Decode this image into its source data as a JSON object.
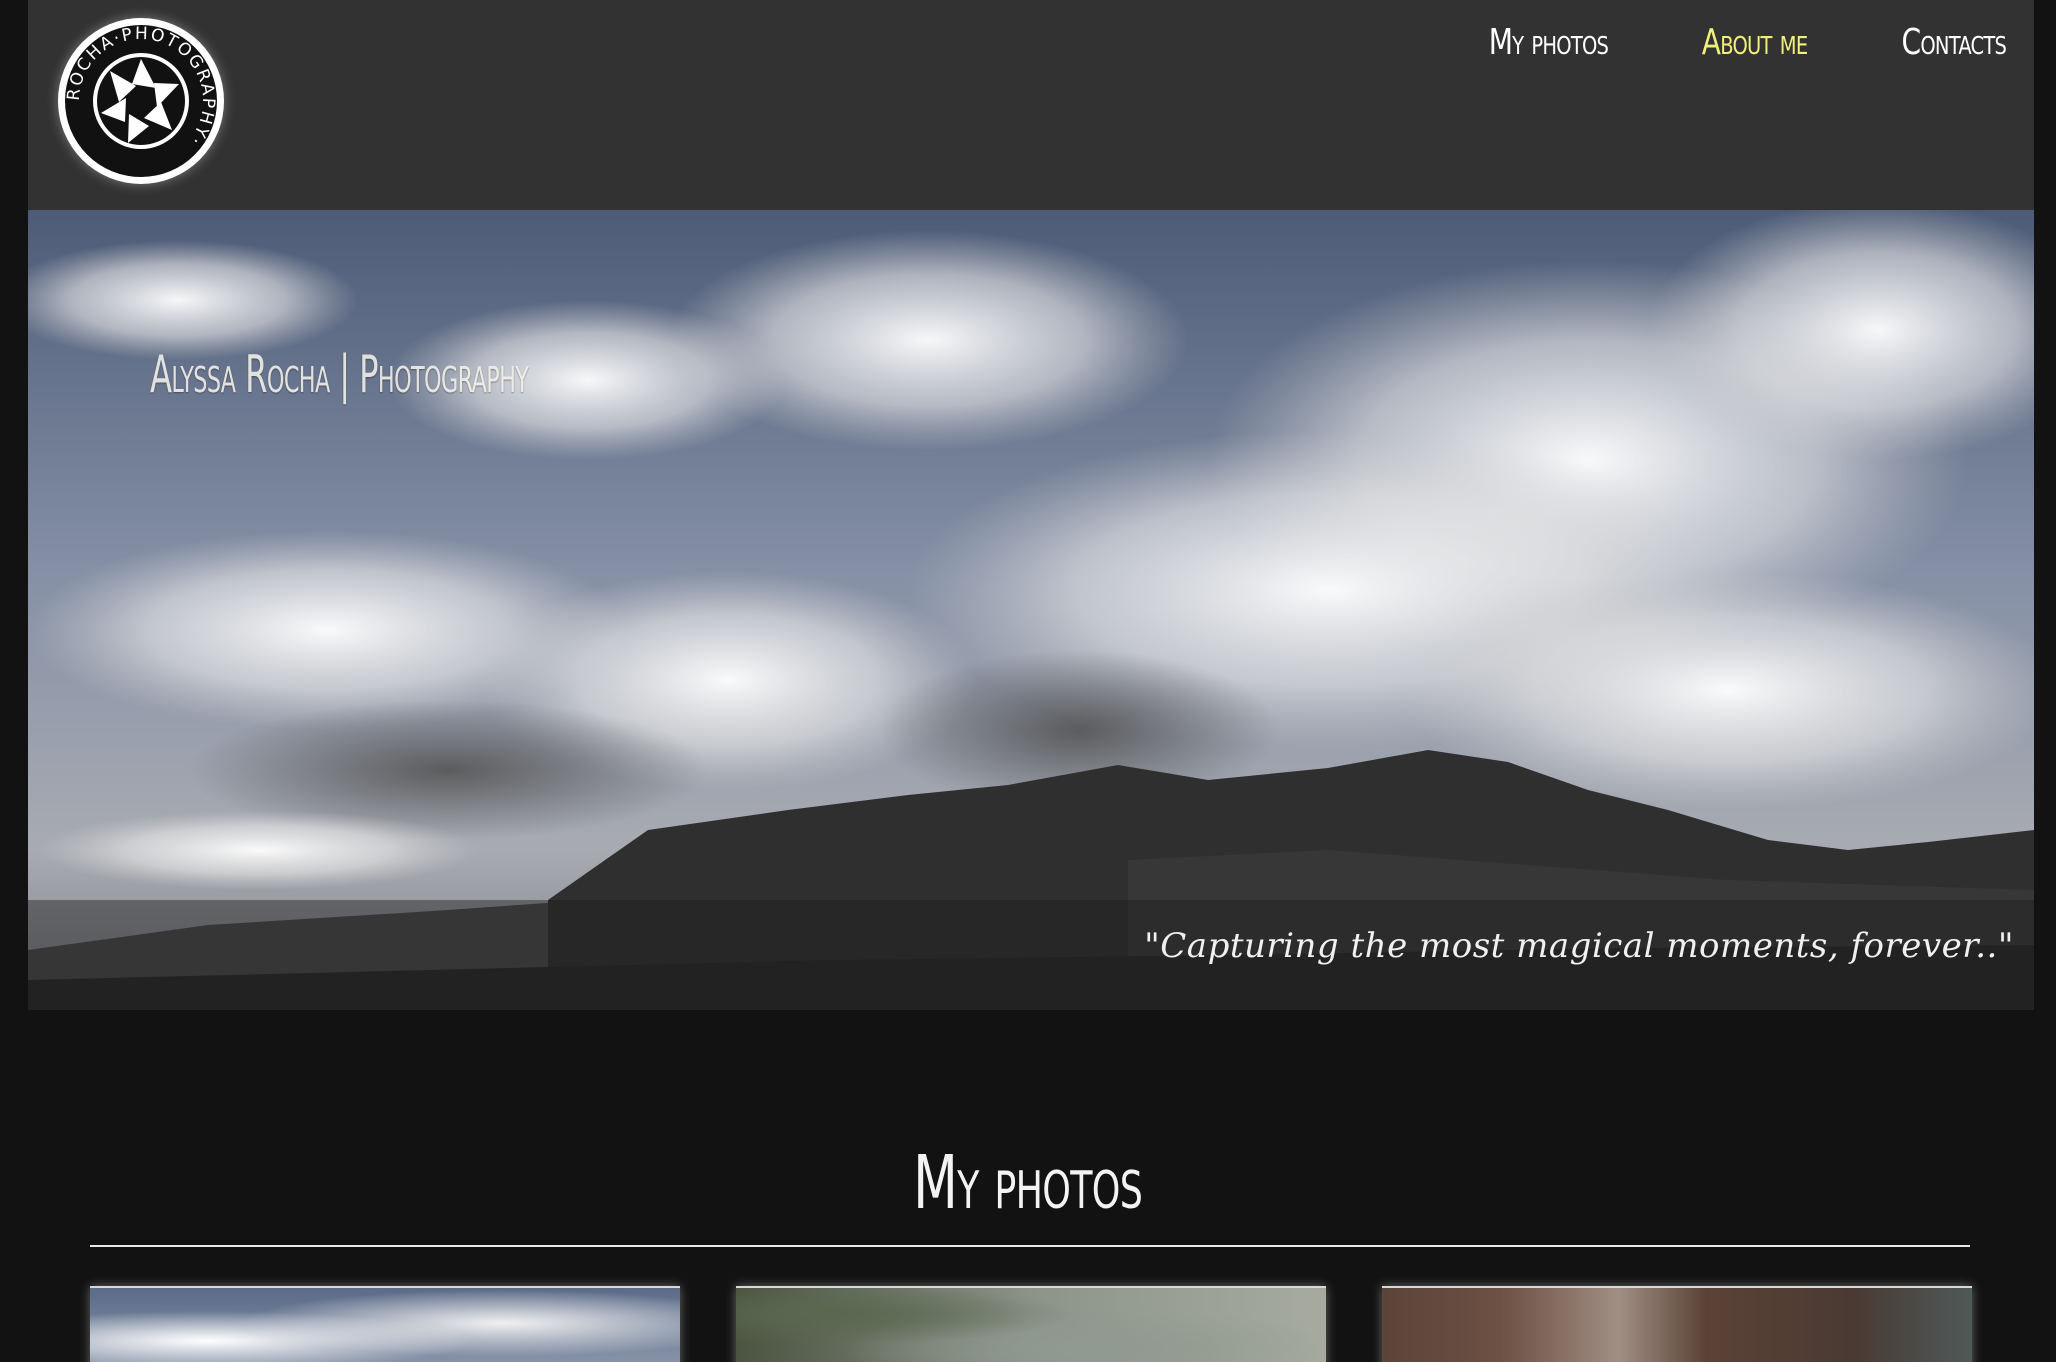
{
  "logo": {
    "ring_text": "ROCHA·PHOTOGRAPHY·",
    "icon": "camera-aperture-icon"
  },
  "nav": {
    "items": [
      {
        "label": "My photos",
        "active": false
      },
      {
        "label": "About me",
        "active": true
      },
      {
        "label": "Contacts",
        "active": false
      }
    ]
  },
  "hero": {
    "title": "Alyssa Rocha | Photography",
    "quote": "\"Capturing the most magical moments, forever..\""
  },
  "section": {
    "title": "My photos"
  },
  "colors": {
    "header_bg": "#323232",
    "page_bg": "#121212",
    "nav_active": "#f2ef7a",
    "text": "#ffffff"
  }
}
